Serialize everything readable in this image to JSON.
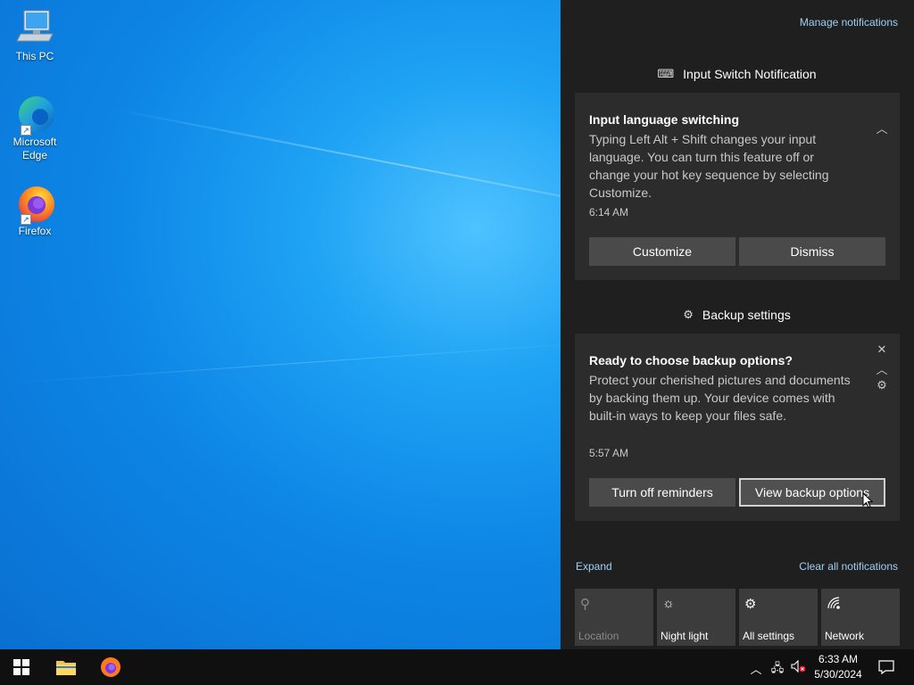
{
  "desktop": {
    "icons": [
      {
        "label": "This PC",
        "icon": "computer-icon"
      },
      {
        "label": "Microsoft Edge",
        "icon": "edge-icon"
      },
      {
        "label": "Firefox",
        "icon": "firefox-icon"
      }
    ]
  },
  "action_center": {
    "manage_link": "Manage notifications",
    "groups": [
      {
        "header": "Input Switch Notification",
        "header_icon": "keyboard-icon",
        "notification": {
          "title": "Input language switching",
          "body": "Typing Left Alt + Shift changes your input language. You can turn this feature off or change your hot key sequence by selecting Customize.",
          "time": "6:14 AM",
          "buttons": [
            "Customize",
            "Dismiss"
          ]
        }
      },
      {
        "header": "Backup settings",
        "header_icon": "gear-icon",
        "notification": {
          "title": "Ready to choose backup options?",
          "body": "Protect your cherished pictures and documents by backing them up. Your device comes with built-in ways to keep your files safe.",
          "time": "5:57 AM",
          "buttons": [
            "Turn off reminders",
            "View backup options"
          ]
        }
      }
    ],
    "expand_link": "Expand",
    "clear_link": "Clear all notifications",
    "quick_actions": [
      {
        "label": "Location",
        "icon": "location-icon",
        "enabled": false
      },
      {
        "label": "Night light",
        "icon": "brightness-icon",
        "enabled": true
      },
      {
        "label": "All settings",
        "icon": "gear-icon",
        "enabled": true
      },
      {
        "label": "Network",
        "icon": "network-icon",
        "enabled": true
      }
    ]
  },
  "taskbar": {
    "pinned": [
      "start-button",
      "file-explorer",
      "firefox"
    ],
    "clock": {
      "time": "6:33 AM",
      "date": "5/30/2024"
    }
  },
  "colors": {
    "accent": "#0a78d7",
    "panel": "#1f1f1f",
    "card": "#2c2c2c",
    "button": "#4a4a4a",
    "link": "#9fd0f5"
  }
}
